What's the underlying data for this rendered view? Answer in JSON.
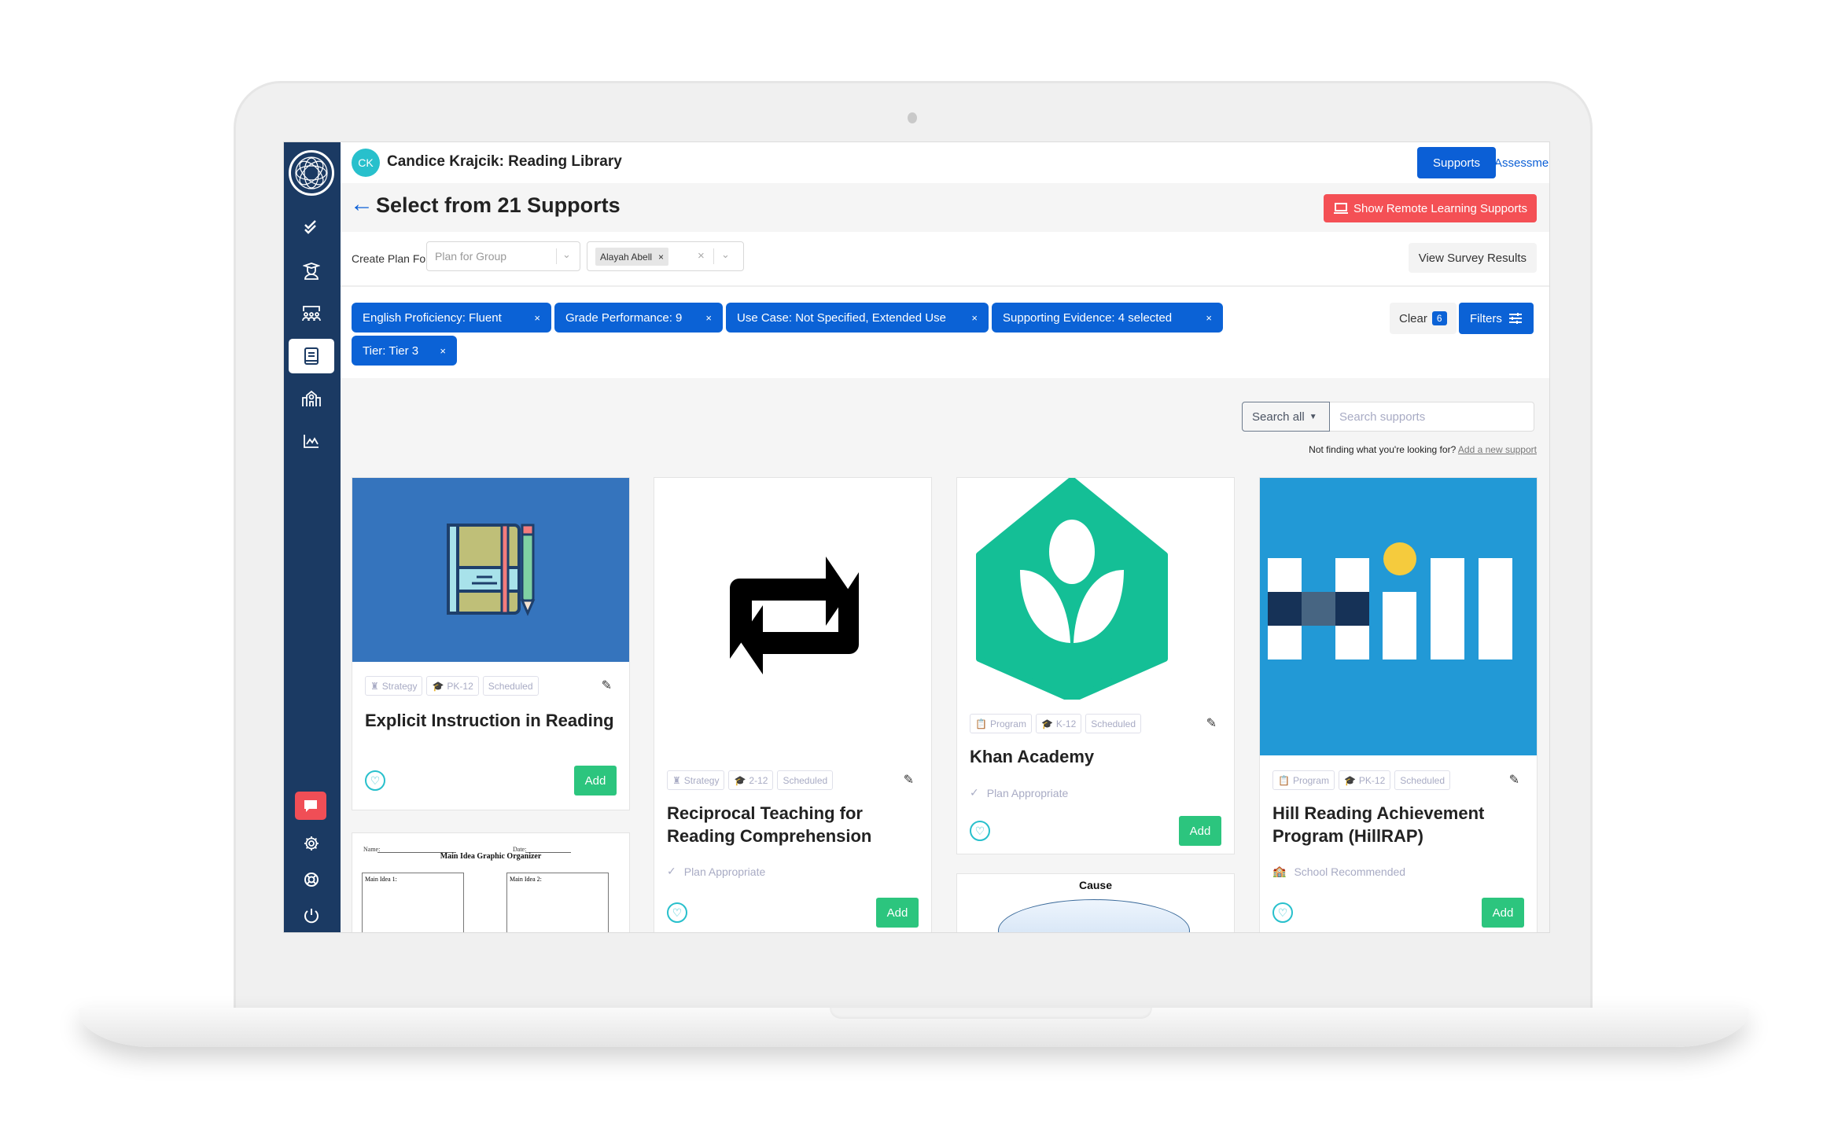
{
  "header": {
    "avatar_initials": "CK",
    "title": "Candice Krajcik: Reading Library",
    "tabs": [
      {
        "label": "Supports",
        "active": true
      },
      {
        "label": "Assessments",
        "active": false
      }
    ]
  },
  "page": {
    "title": "Select from 21 Supports",
    "remote_button": "Show Remote Learning Supports",
    "view_survey_button": "View Survey Results"
  },
  "plan": {
    "label": "Create Plan For",
    "group_select_placeholder": "Plan for Group",
    "student_selected": "Alayah Abell"
  },
  "filters": {
    "chips": [
      "English Proficiency: Fluent",
      "Grade Performance: 9",
      "Use Case: Not Specified, Extended Use",
      "Supporting Evidence: 4 selected",
      "Tier: Tier 3"
    ],
    "clear_label": "Clear",
    "clear_count": "6",
    "filters_label": "Filters"
  },
  "search": {
    "scope_label": "Search all",
    "placeholder": "Search supports",
    "not_finding": "Not finding what you're looking for?",
    "add_new_link": "Add a new support"
  },
  "sidebar": {
    "items": [
      "checklist",
      "students",
      "groups",
      "library",
      "school",
      "reports"
    ],
    "active": "library",
    "bottom": [
      "chat",
      "settings",
      "help",
      "logout"
    ]
  },
  "cards": [
    {
      "type": "Strategy",
      "grades": "PK-12",
      "schedule": "Scheduled",
      "title": "Explicit Instruction in Reading",
      "note": "",
      "add_label": "Add"
    },
    {
      "type": "Strategy",
      "grades": "2-12",
      "schedule": "Scheduled",
      "title": "Reciprocal Teaching for Reading Comprehension",
      "note": "Plan Appropriate",
      "add_label": "Add"
    },
    {
      "type": "Program",
      "grades": "K-12",
      "schedule": "Scheduled",
      "title": "Khan Academy",
      "note": "Plan Appropriate",
      "add_label": "Add"
    },
    {
      "type": "Program",
      "grades": "PK-12",
      "schedule": "Scheduled",
      "title": "Hill Reading Achievement Program (HillRAP)",
      "note": "School Recommended",
      "add_label": "Add"
    }
  ],
  "partial_cards": {
    "organizer": {
      "name_label": "Name:",
      "date_label": "Date:",
      "title": "Main Idea Graphic Organizer",
      "box1": "Main Idea 1:",
      "box2": "Main Idea 2:"
    },
    "cause": {
      "title": "Cause"
    }
  },
  "colors": {
    "primary": "#0b62d6",
    "sidebar": "#1b3a63",
    "danger": "#f45055",
    "success": "#2cc57e",
    "accent": "#28c0cc"
  }
}
